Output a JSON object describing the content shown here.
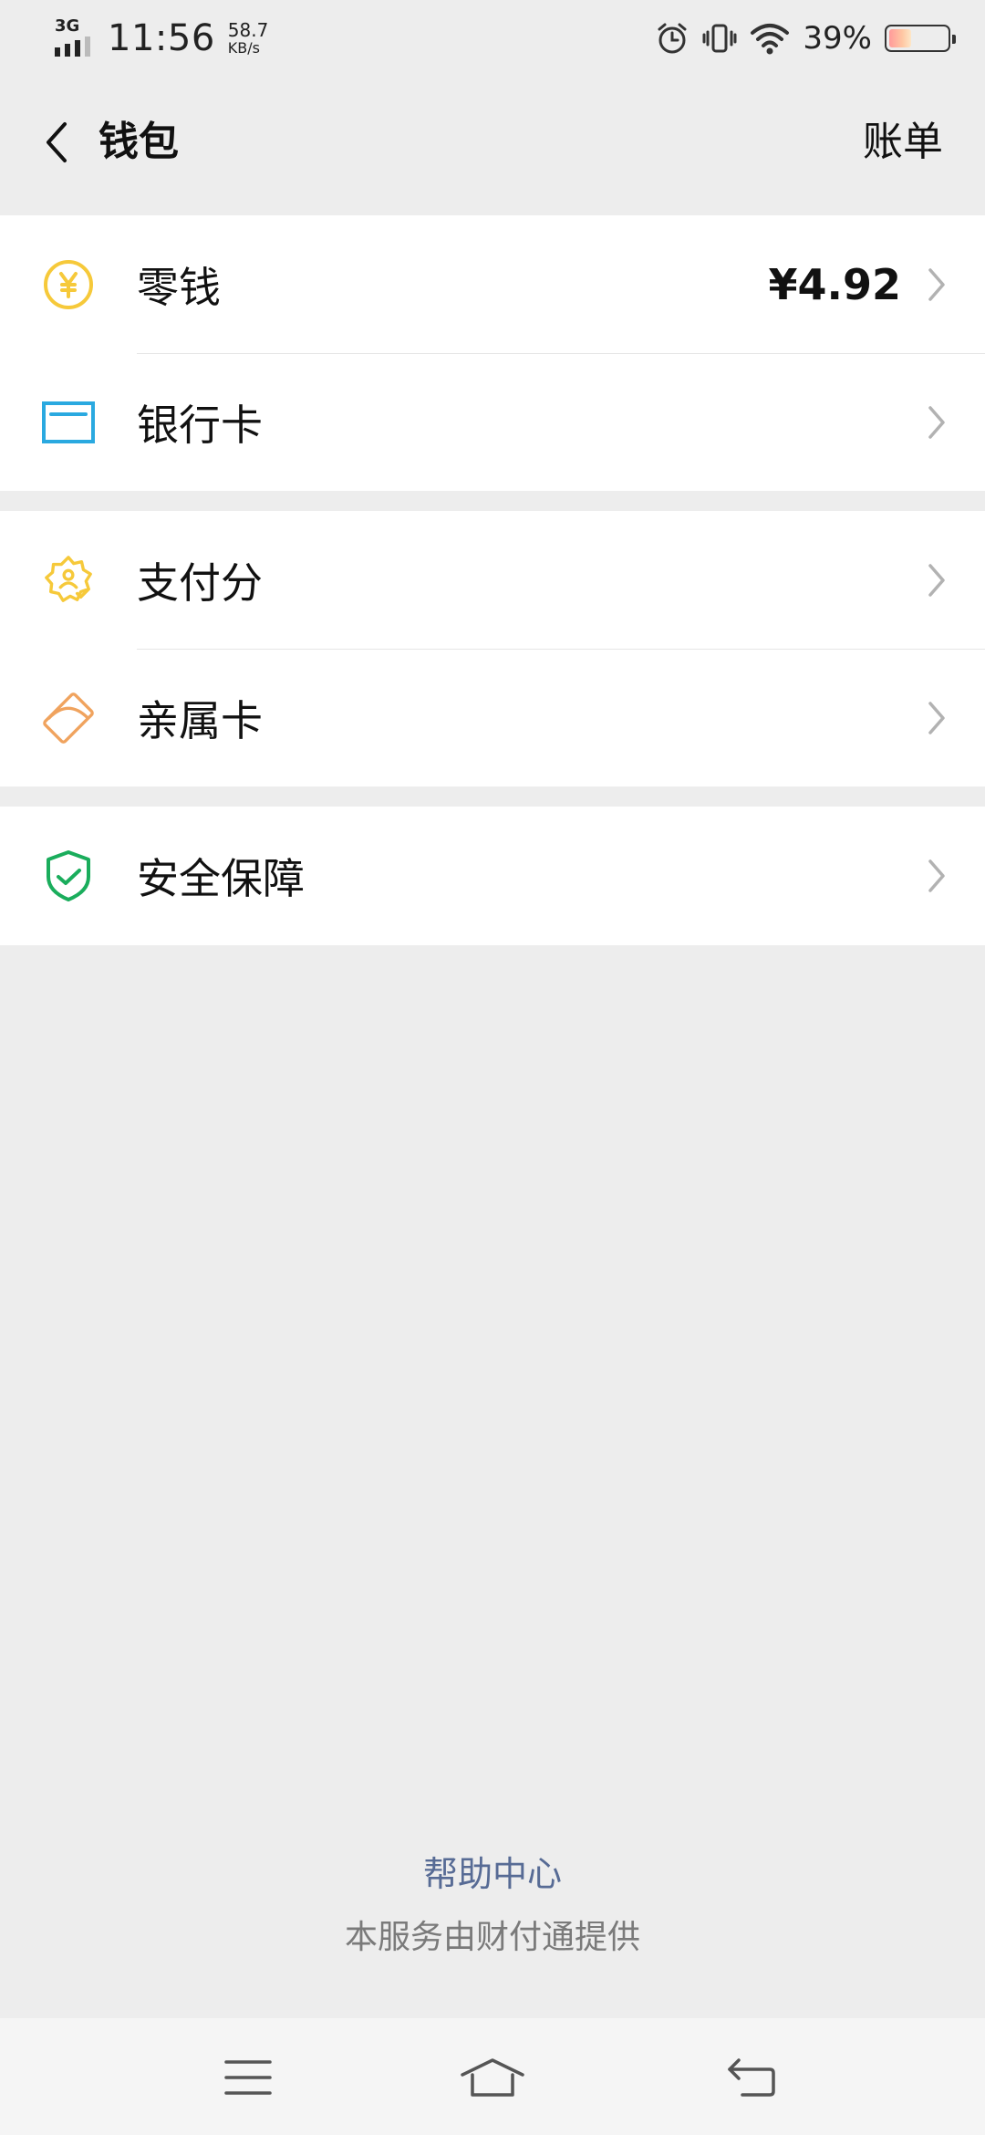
{
  "status_bar": {
    "network": "3G",
    "time": "11:56",
    "speed_value": "58.7",
    "speed_unit": "KB/s",
    "battery_percent_text": "39%",
    "battery_level": 0.39,
    "icons": [
      "alarm-icon",
      "vibrate-icon",
      "wifi-icon",
      "battery-icon"
    ]
  },
  "header": {
    "back_icon": "chevron-left-icon",
    "title": "钱包",
    "right_action": "账单"
  },
  "groups": [
    {
      "items": [
        {
          "label": "零钱",
          "value": "¥4.92",
          "icon": "yuan-coin-icon",
          "color": "#f6c93a"
        },
        {
          "label": "银行卡",
          "icon": "bank-card-icon",
          "color": "#2aa9e0"
        }
      ]
    },
    {
      "items": [
        {
          "label": "支付分",
          "icon": "pay-score-badge-icon",
          "color": "#f6c93a"
        },
        {
          "label": "亲属卡",
          "icon": "family-card-icon",
          "color": "#f0a35e"
        }
      ]
    },
    {
      "items": [
        {
          "label": "安全保障",
          "icon": "shield-check-icon",
          "color": "#1aad5c"
        }
      ]
    }
  ],
  "footer": {
    "help_link": "帮助中心",
    "provider_text": "本服务由财付通提供",
    "link_color": "#576b95"
  },
  "system_nav": {
    "buttons": [
      "menu-icon",
      "home-icon",
      "back-icon"
    ]
  }
}
